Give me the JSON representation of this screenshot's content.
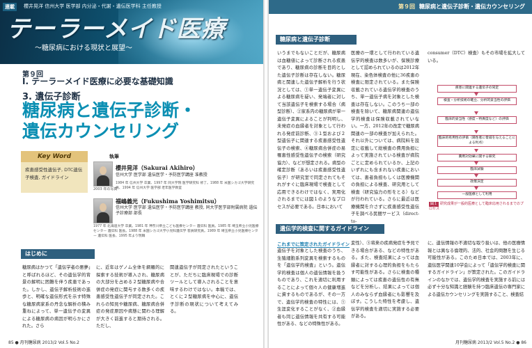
{
  "left": {
    "series_tag": "連載",
    "series_author": "櫻井晃洋 信州大学 医学部 内分泌・代謝・遺伝医学科 主任教授",
    "series_title": "テーラーメイド医療",
    "series_subtitle": "〜糖尿病における現状と展望〜",
    "kaisuu": "第９回",
    "part_heading": "I. テーラーメイド医療に必要な基礎知識",
    "sub_heading": "3. 遺伝子診断",
    "title_line1": "糖尿病と遺伝子診断・",
    "title_line2": "遺伝カウンセリング",
    "keyword": {
      "title": "Key Word",
      "body": "疾患感受性遺伝子, DTC遺伝子検査, ガイドライン"
    },
    "author_label": "執筆",
    "authors": [
      {
        "name": "櫻井晃洋（Sakurai Akihiro）",
        "affiliation": "信州大学 医学部 遺伝医学・予防医学講座 准教授",
        "photo_caption": "2003 年の写真",
        "bio": "1984 年 信州大学 卒業、1997 年 同大学院 医学研究科 修了。1988 年 米国シカゴ大学研究員、1994 年 信州大学 医学部 老年医学教室"
      },
      {
        "name": "福嶋義光（Fukushima Yoshimitsu）",
        "affiliation": "信州大学 医学部 遺伝医学・予防医学講座 教授, 同大学医学部附属病院 遺伝子診療部 部長",
        "bio": "1977 年 北海道大学 卒業。1981 年 神奈川県立こども医療センター 遺伝科 医員。1985 年 埼玉県立小児医療センター 遺伝科 医長。1988 年 米国シカゴ大学小児科遺伝学 客員研究員。1989 年 埼玉県立小児医療センター 遺伝科 医長、1995 年より現職"
      }
    ],
    "section_hajimeni": "はじめに",
    "body_col1": "糖尿病はかつて「遺伝学者の悪夢」と呼ばれるほど、その遺伝学的背景の解明に困難を伴う疾患であった。しかし、遺伝子解析技術の進歩と、明確な遺伝形式を示す特殊な糖尿病家系の丹念な解析の積み重ねによって、単一遺伝子の変異による糖尿病の病因が明らかにされた。さら",
    "body_col2": "に、近年はゲノム全体を網羅的に探索する技術が導入され、糖尿病の大部分を占める２型糖尿病や合併症の発症に関与する数多くの疾患感受性遺伝子が同定された。これらの知見や糖尿病、糖尿病合併症の発症原因や病態に関わる理解が大きく前進すると期待される。ただし、",
    "body_col3": "関連遺伝子が同定されたということが、ただちに臨床現場での診断ツールとして導入されることを意味するわけではない。本稿では、とくに２型糖尿病を中心に、遺伝子診断の現状について考えてみる。",
    "footer": "85 ● 月刊糖尿病 2013/2 Vol.5 No.2"
  },
  "right": {
    "header_kai": "第９回",
    "header_title": "糖尿病と遺伝子診断・遺伝カウンセリング",
    "section_iden": "糖尿病と遺伝子診断",
    "col1": "いうまでもないことだが、糖尿病は血糖値によって診断される疾患であり、糖尿病の診断を目的とした遺伝子診断は存在しない。糖尿病と関連した遺伝子解析を行う状況としては、①単一遺伝子変異による糖尿病を疑い、発端者に対して当該遺伝子を検索する場合（病型診断）、②家系内の糖尿病が単一遺伝子変異によることが判明し、未発症の血縁者を対象として行われる発症前診断、③１型および２型遺伝子に関連する疾患感受性遺伝子の検索、④糖尿病合併症の易罹患性感受性遺伝子の検索（研究協力）、などが想定される。病型の確定診断（あるいは疾患感受性遺伝子）が研究室で同定されてもそれがすぐに臨床現場で検査として応用できるわけではなく、実用化されるまでには図１のようなプロセスが必要である。日本において",
    "col2": "医療の一環として行われている遺伝学的検査は数多いが、保険診療として認められているのは2012年現在、染色体検査の他に36疾患の検査に限定されている。また保険収載されている遺伝学的検査のうち、単一遺伝子病を対象とした検査は存在しない。このうち一部の検査を除いて、糖尿病関連の遺伝学的検査は保険収載されていない。一方、2012年の改定で糖尿病関連の一部の検査が加えられた。それ以外については、病院料を設定に収載して総検査の費用負担によって実施されている検査が病院ごとに定められているか、上記のいずれにも含まれない疾患においては、患者負担もしくは医療機関の負担による検査、研究用として検査（研究協力の形をとる）などが行われている。さらに最近は医療機関を介さずに疾患感受性遺伝子を調べる民間サービス（direct-to-",
    "col3": "consumer（DTC）検査）もその市場を拡大している。",
    "figure_steps": [
      "疾患に関連する遺伝子の同定",
      "検査・分析技術の確立、分析的妥当性の評価",
      "臨床的妥当性（感度・特異度など）の評価",
      "臨床的有用性の評価（陽性者に脅威を与えることによる利点）",
      "費用対効果に関する研究",
      "臨床試験",
      "政策決定",
      "一般医療として利用"
    ],
    "figure_tag": "図１",
    "figure_caption": "研究成果が一般的医療として臨床応用されるまでのプロセス",
    "section_guideline": "遺伝学的検査に関するガイドライン",
    "sub_section": "これまでに策定されたガイドライン",
    "bottom_col1": "遺伝子を対象とした検査のうち、生殖細胞系列変異を検索するものを「遺伝学的検査」という。遺伝学的検査は個人の遺伝情報を扱うものであり、これを適切に利用することによって個々人の健康増進に資するものであるが、その一方で、遺伝学的検査の特性には、①生涯変化することがなく、②血縁者も同じ遺伝情報を共有する可能性がある、などの特殊性がある。",
    "bottom_col2": "変性）、③将来の疾病発症を予見できる場合がある、などの特性がある。また、検査結果によっては血縁者に対する心理的負担をもたらす可能性がある。さらに検査の種類によっては疾患の遺伝性の有無などを分析し、結果によっては個人のみならず血縁者にも影響を及ぼす。こうした特性を考慮し、遺伝学的検査を適切に実施する必要がある。",
    "bottom_col3": "に、遺伝情報の不適切な取り扱いは、他の医療情報とは異なる倫理的、法的、社会的問題を生じる可能性がある。このため日本では、2003年に、遺伝医学関連10学会によって「遺伝学的検査に関するガイドライン」が策定された。このガイドラインのなかでは、遺伝学的検査を実施する前には必ず十分な知識と経験を持つ臨床遺伝の専門家による遺伝カウンセリングを実施すること、検査結",
    "footer": "月刊糖尿病 2013/2 Vol.5 No.2 ● 86"
  }
}
